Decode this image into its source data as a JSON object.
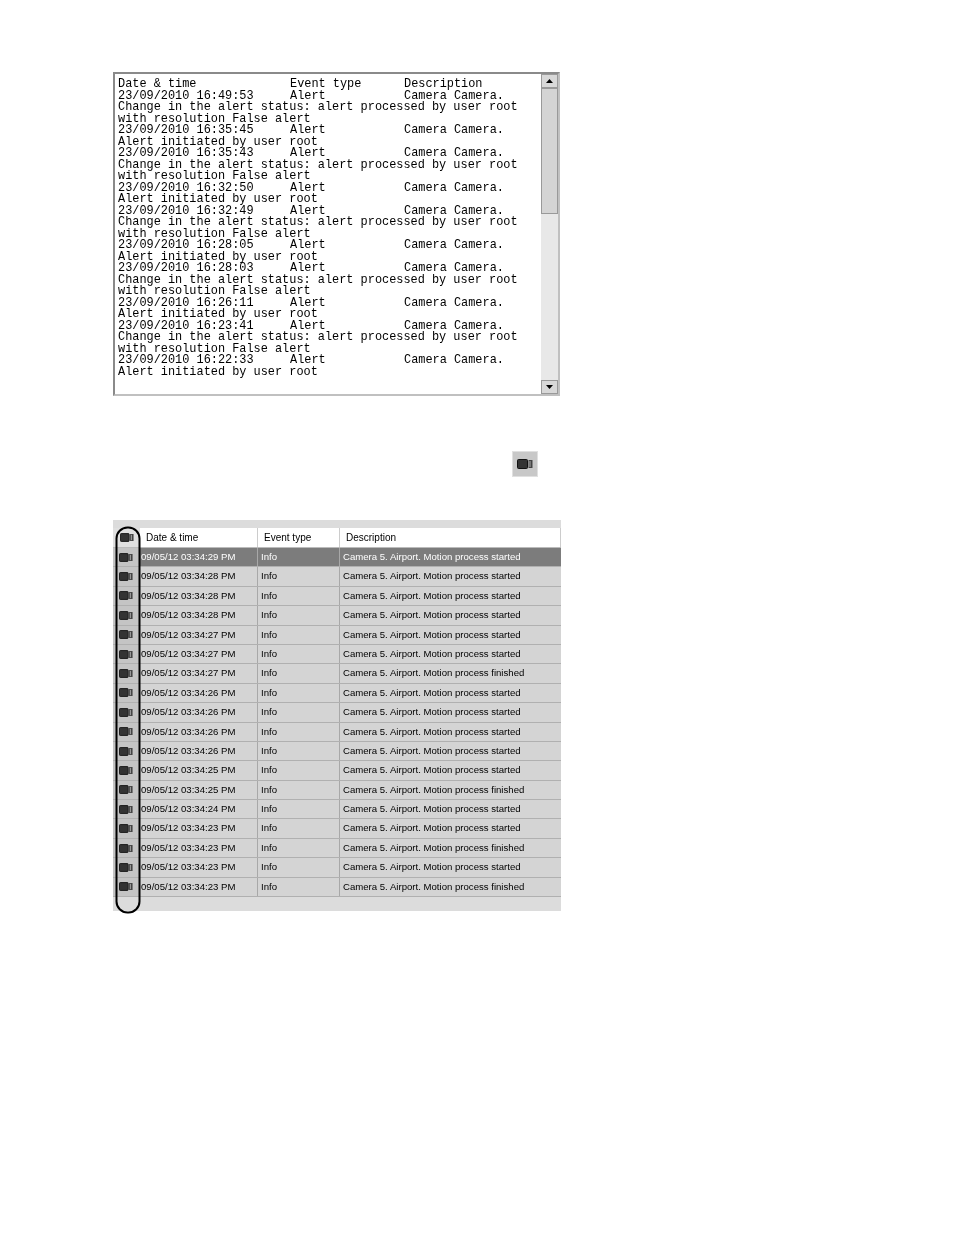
{
  "alert_log": {
    "columns": [
      "Date & time",
      "Event type",
      "Description"
    ],
    "entries": [
      {
        "date": "23/09/2010 16:49:53",
        "type": "Alert",
        "description": "Camera Camera.",
        "message": [
          "Change in the alert status: alert processed by user root",
          "with resolution False alert"
        ]
      },
      {
        "date": "23/09/2010 16:35:45",
        "type": "Alert",
        "description": "Camera Camera.",
        "message": [
          "Alert initiated by user root"
        ]
      },
      {
        "date": "23/09/2010 16:35:43",
        "type": "Alert",
        "description": "Camera Camera.",
        "message": [
          "Change in the alert status: alert processed by user root",
          "with resolution False alert"
        ]
      },
      {
        "date": "23/09/2010 16:32:50",
        "type": "Alert",
        "description": "Camera Camera.",
        "message": [
          "Alert initiated by user root"
        ]
      },
      {
        "date": "23/09/2010 16:32:49",
        "type": "Alert",
        "description": "Camera Camera.",
        "message": [
          "Change in the alert status: alert processed by user root",
          "with resolution False alert"
        ]
      },
      {
        "date": "23/09/2010 16:28:05",
        "type": "Alert",
        "description": "Camera Camera.",
        "message": [
          "Alert initiated by user root"
        ]
      },
      {
        "date": "23/09/2010 16:28:03",
        "type": "Alert",
        "description": "Camera Camera.",
        "message": [
          "Change in the alert status: alert processed by user root",
          "with resolution False alert"
        ]
      },
      {
        "date": "23/09/2010 16:26:11",
        "type": "Alert",
        "description": "Camera Camera.",
        "message": [
          "Alert initiated by user root"
        ]
      },
      {
        "date": "23/09/2010 16:23:41",
        "type": "Alert",
        "description": "Camera Camera.",
        "message": [
          "Change in the alert status: alert processed by user root",
          "with resolution False alert"
        ]
      },
      {
        "date": "23/09/2010 16:22:33",
        "type": "Alert",
        "description": "Camera Camera.",
        "message": [
          "Alert initiated by user root"
        ]
      }
    ]
  },
  "event_table": {
    "columns": [
      "Date & time",
      "Event type",
      "Description"
    ],
    "rows": [
      {
        "date": "09/05/12 03:34:29 PM",
        "type": "Info",
        "description": "Camera 5. Airport. Motion process started",
        "selected": true
      },
      {
        "date": "09/05/12 03:34:28 PM",
        "type": "Info",
        "description": "Camera 5. Airport. Motion process started",
        "selected": false
      },
      {
        "date": "09/05/12 03:34:28 PM",
        "type": "Info",
        "description": "Camera 5. Airport. Motion process started",
        "selected": false
      },
      {
        "date": "09/05/12 03:34:28 PM",
        "type": "Info",
        "description": "Camera 5. Airport. Motion process started",
        "selected": false
      },
      {
        "date": "09/05/12 03:34:27 PM",
        "type": "Info",
        "description": "Camera 5. Airport. Motion process started",
        "selected": false
      },
      {
        "date": "09/05/12 03:34:27 PM",
        "type": "Info",
        "description": "Camera 5. Airport. Motion process started",
        "selected": false
      },
      {
        "date": "09/05/12 03:34:27 PM",
        "type": "Info",
        "description": "Camera 5. Airport. Motion process finished",
        "selected": false
      },
      {
        "date": "09/05/12 03:34:26 PM",
        "type": "Info",
        "description": "Camera 5. Airport. Motion process started",
        "selected": false
      },
      {
        "date": "09/05/12 03:34:26 PM",
        "type": "Info",
        "description": "Camera 5. Airport. Motion process started",
        "selected": false
      },
      {
        "date": "09/05/12 03:34:26 PM",
        "type": "Info",
        "description": "Camera 5. Airport. Motion process started",
        "selected": false
      },
      {
        "date": "09/05/12 03:34:26 PM",
        "type": "Info",
        "description": "Camera 5. Airport. Motion process started",
        "selected": false
      },
      {
        "date": "09/05/12 03:34:25 PM",
        "type": "Info",
        "description": "Camera 5. Airport. Motion process started",
        "selected": false
      },
      {
        "date": "09/05/12 03:34:25 PM",
        "type": "Info",
        "description": "Camera 5. Airport. Motion process finished",
        "selected": false
      },
      {
        "date": "09/05/12 03:34:24 PM",
        "type": "Info",
        "description": "Camera 5. Airport. Motion process started",
        "selected": false
      },
      {
        "date": "09/05/12 03:34:23 PM",
        "type": "Info",
        "description": "Camera 5. Airport. Motion process started",
        "selected": false
      },
      {
        "date": "09/05/12 03:34:23 PM",
        "type": "Info",
        "description": "Camera 5. Airport. Motion process finished",
        "selected": false
      },
      {
        "date": "09/05/12 03:34:23 PM",
        "type": "Info",
        "description": "Camera 5. Airport. Motion process started",
        "selected": false
      },
      {
        "date": "09/05/12 03:34:23 PM",
        "type": "Info",
        "description": "Camera 5. Airport. Motion process finished",
        "selected": false
      }
    ]
  }
}
